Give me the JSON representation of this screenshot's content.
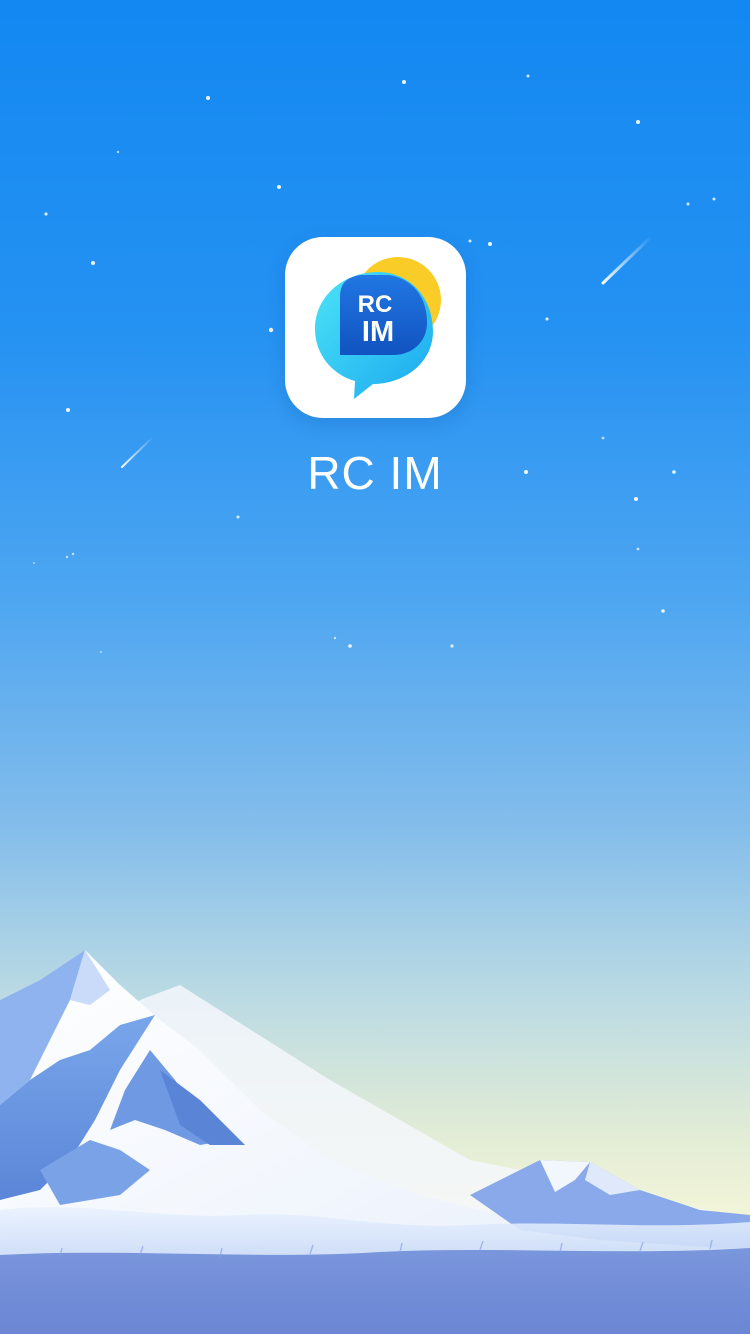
{
  "splash": {
    "app_name": "RC IM",
    "logo": {
      "icon": "rc-im-chat-bubble-icon",
      "line1": "RC",
      "line2": "IM"
    }
  },
  "colors": {
    "sky_top": "#1388f2",
    "sky_bottom": "#f3f4de",
    "icon_background": "#ffffff",
    "bubble_blue": "#1b6bd6",
    "bubble_cyan": "#3fd0f3",
    "bubble_yellow": "#f9cc28",
    "mountain_snow": "#eef4ff",
    "mountain_shadow": "#6f9ee6",
    "ground": "#6e8ad8"
  }
}
